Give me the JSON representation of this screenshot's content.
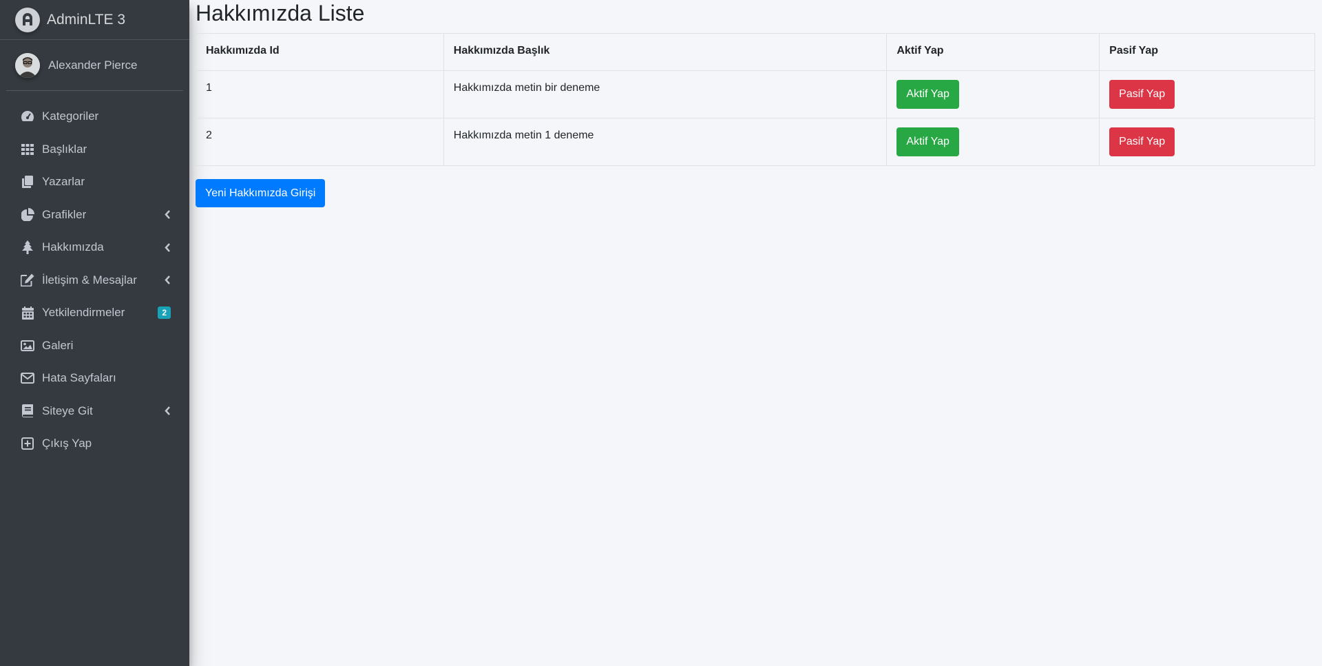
{
  "brand": {
    "title": "AdminLTE 3"
  },
  "user": {
    "name": "Alexander Pierce"
  },
  "sidebar": {
    "items": [
      {
        "label": "Kategoriler",
        "icon": "tachometer-icon",
        "has_chevron": false
      },
      {
        "label": "Başlıklar",
        "icon": "th-grid-icon",
        "has_chevron": false
      },
      {
        "label": "Yazarlar",
        "icon": "copy-icon",
        "has_chevron": false
      },
      {
        "label": "Grafikler",
        "icon": "chart-pie-icon",
        "has_chevron": true
      },
      {
        "label": "Hakkımızda",
        "icon": "tree-icon",
        "has_chevron": true
      },
      {
        "label": "İletişim & Mesajlar",
        "icon": "edit-icon",
        "has_chevron": true
      },
      {
        "label": "Yetkilendirmeler",
        "icon": "calendar-icon",
        "badge": "2",
        "has_chevron": false
      },
      {
        "label": "Galeri",
        "icon": "image-icon",
        "has_chevron": false
      },
      {
        "label": "Hata Sayfaları",
        "icon": "envelope-icon",
        "has_chevron": false
      },
      {
        "label": "Siteye Git",
        "icon": "book-icon",
        "has_chevron": true
      },
      {
        "label": "Çıkış Yap",
        "icon": "plus-square-icon",
        "has_chevron": false
      }
    ]
  },
  "main": {
    "title": "Hakkımızda Liste",
    "table": {
      "headers": [
        "Hakkımızda Id",
        "Hakkımızda Başlık",
        "Aktif Yap",
        "Pasif Yap"
      ],
      "rows": [
        {
          "id": "1",
          "title": "Hakkımızda metin bir deneme",
          "activate_label": "Aktif Yap",
          "deactivate_label": "Pasif Yap"
        },
        {
          "id": "2",
          "title": "Hakkımızda metin 1 deneme",
          "activate_label": "Aktif Yap",
          "deactivate_label": "Pasif Yap"
        }
      ]
    },
    "new_button_label": "Yeni Hakkımızda Girişi"
  },
  "colors": {
    "sidebar_bg": "#343a40",
    "content_bg": "#f4f6f9",
    "success": "#28a745",
    "danger": "#dc3545",
    "primary": "#007bff",
    "badge_info": "#17a2b8"
  }
}
